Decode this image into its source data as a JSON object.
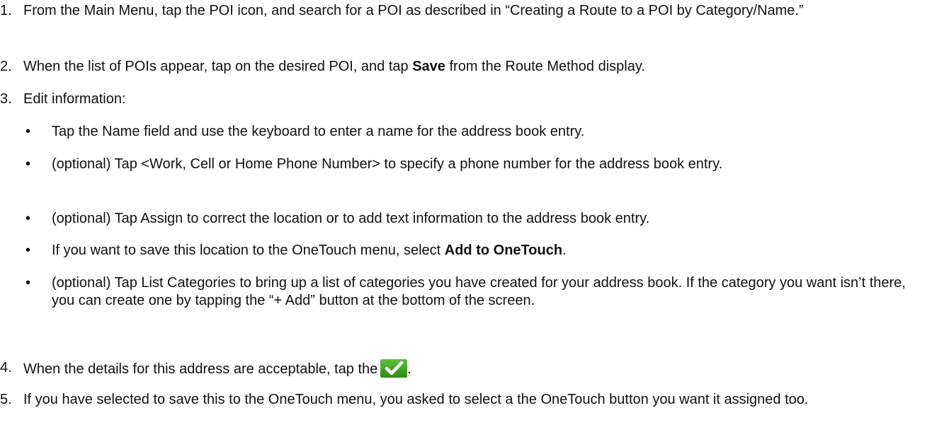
{
  "steps": [
    {
      "num": "1.",
      "text": "From the Main Menu, tap the POI icon, and search for a POI as described in “Creating a Route to a POI by Category/Name.”"
    },
    {
      "num": "2.",
      "pre": "When the list of POIs appear, tap on the desired POI, and tap ",
      "bold": "Save",
      "post": " from the Route Method display."
    },
    {
      "num": "3.",
      "text": "Edit information:"
    },
    {
      "num": "4.",
      "pre": "When the details for this address are acceptable, tap the",
      "post": "."
    },
    {
      "num": "5.",
      "text": "If you have selected to save this to the OneTouch menu, you asked to select a the OneTouch button you want it assigned too."
    }
  ],
  "substeps": [
    {
      "bullet": "•",
      "text": "Tap the Name field and use the keyboard to enter a name for the address book entry."
    },
    {
      "bullet": "•",
      "text": "(optional) Tap <Work, Cell or Home Phone Number> to specify a phone number for the address book entry."
    },
    {
      "bullet": "•",
      "text": "(optional) Tap Assign to correct the location or to add text information to the address book entry."
    },
    {
      "bullet": "•",
      "pre": "If you want to save this location to the OneTouch menu, select ",
      "bold": "Add to OneTouch",
      "post": "."
    },
    {
      "bullet": "•",
      "text": "(optional) Tap List Categories to bring up a list of categories you have created for your address book.  If the category you want isn’t there, you can create one by tapping the “+ Add” button at the bottom of the screen."
    }
  ],
  "icons": {
    "confirm": "checkmark-icon",
    "confirm_color": "#3a9a1c"
  }
}
